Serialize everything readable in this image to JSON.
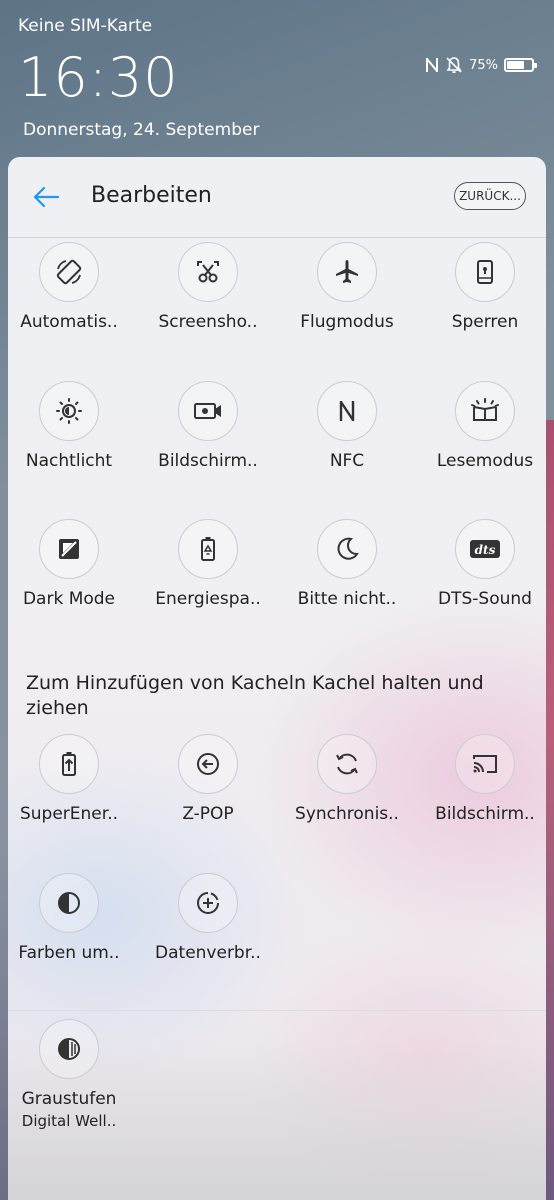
{
  "status_bar": {
    "carrier": "Keine SIM-Karte",
    "time": "16:30",
    "date": "Donnerstag, 24. September",
    "battery_percent": "75%",
    "battery_level": 0.75,
    "icons": [
      "nfc-icon",
      "bell-off-icon",
      "battery-icon"
    ]
  },
  "header": {
    "title": "Bearbeiten",
    "reset_label": "ZURÜCK...",
    "accent_color": "#2196f3"
  },
  "active_tiles": [
    {
      "label": "Automatis..",
      "icon": "auto-rotate-icon"
    },
    {
      "label": "Screensho..",
      "icon": "screenshot-icon"
    },
    {
      "label": "Flugmodus",
      "icon": "airplane-icon"
    },
    {
      "label": "Sperren",
      "icon": "lock-screen-icon"
    },
    {
      "label": "Nachtlicht",
      "icon": "night-light-icon"
    },
    {
      "label": "Bildschirm..",
      "icon": "screen-record-icon"
    },
    {
      "label": "NFC",
      "icon": "nfc-icon"
    },
    {
      "label": "Lesemodus",
      "icon": "reading-mode-icon"
    },
    {
      "label": "Dark Mode",
      "icon": "dark-mode-icon"
    },
    {
      "label": "Energiespa..",
      "icon": "battery-saver-icon"
    },
    {
      "label": "Bitte nicht..",
      "icon": "moon-icon"
    },
    {
      "label": "DTS-Sound",
      "icon": "dts-icon"
    }
  ],
  "hint": "Zum Hinzufügen von Kacheln Kachel halten und ziehen",
  "available_tiles": [
    {
      "label": "SuperEner..",
      "icon": "super-power-saving-icon"
    },
    {
      "label": "Z-POP",
      "icon": "z-pop-icon"
    },
    {
      "label": "Synchronis..",
      "icon": "sync-icon"
    },
    {
      "label": "Bildschirm..",
      "icon": "cast-icon"
    },
    {
      "label": "Farben um..",
      "icon": "invert-colors-icon"
    },
    {
      "label": "Datenverbr..",
      "icon": "data-saver-icon"
    }
  ],
  "extra_tiles": [
    {
      "label": "Graustufen",
      "sub": "Digital Well..",
      "icon": "grayscale-icon"
    }
  ]
}
